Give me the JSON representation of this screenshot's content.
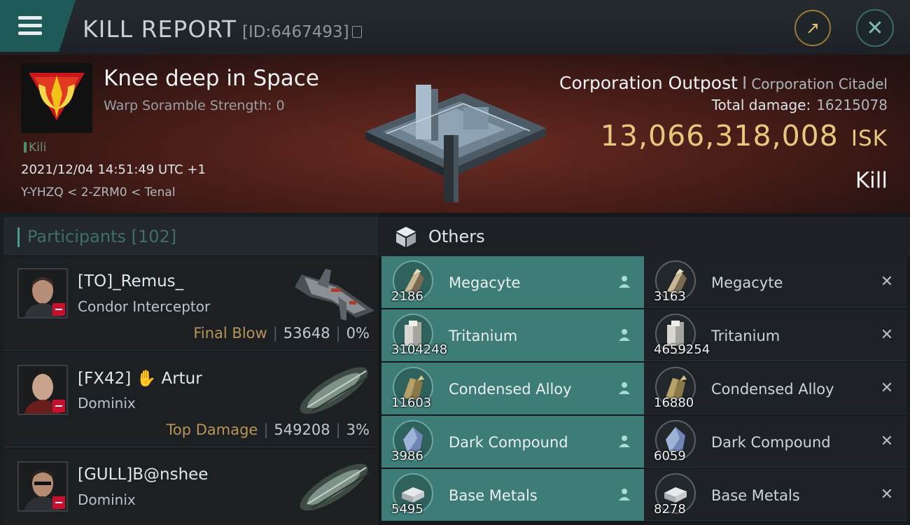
{
  "header": {
    "title": "KILL REPORT",
    "report_id": "[ID:6467493]"
  },
  "victim": {
    "name": "Knee deep in Space",
    "scramble": "Warp Soramble Strength: 0",
    "tag": "Kili",
    "timestamp": "2021/12/04 14:51:49 UTC +1",
    "location": "Y-YHZQ < 2-ZRM0 < Tenal"
  },
  "target": {
    "ship_type": "Corporation Outpost",
    "separator": "I",
    "ship_class": "Corporation Citadel",
    "total_damage_label": "Total damage:",
    "total_damage_value": "16215078",
    "isk_value": "13,066,318,008",
    "isk_unit": "ISK",
    "result": "Kill"
  },
  "participants": {
    "title": "Participants [102]",
    "rows": [
      {
        "name": "[TO]_Remus_",
        "ship": "Condor Interceptor",
        "label": "Final Blow",
        "damage": "53648",
        "pct": "0%"
      },
      {
        "name": "[FX42] ✋ Artur",
        "ship": "Dominix",
        "label": "Top Damage",
        "damage": "549208",
        "pct": "3%"
      },
      {
        "name": "[GULL]B@nshee",
        "ship": "Dominix",
        "label": "",
        "damage": "",
        "pct": ""
      }
    ]
  },
  "others": {
    "title": "Others",
    "dropped": [
      {
        "name": "Megacyte",
        "qty": "2186"
      },
      {
        "name": "Tritanium",
        "qty": "3104248"
      },
      {
        "name": "Condensed Alloy",
        "qty": "11603"
      },
      {
        "name": "Dark Compound",
        "qty": "3986"
      },
      {
        "name": "Base Metals",
        "qty": "5495"
      }
    ],
    "destroyed": [
      {
        "name": "Megacyte",
        "qty": "3163"
      },
      {
        "name": "Tritanium",
        "qty": "4659254"
      },
      {
        "name": "Condensed Alloy",
        "qty": "16880"
      },
      {
        "name": "Dark Compound",
        "qty": "6059"
      },
      {
        "name": "Base Metals",
        "qty": "8278"
      }
    ],
    "destroyed_icon": "✕"
  },
  "colors": {
    "accent": "#3d7c77",
    "isk": "#e7c77e",
    "security_status": "#c8102e",
    "label_gold": "#b89556"
  }
}
